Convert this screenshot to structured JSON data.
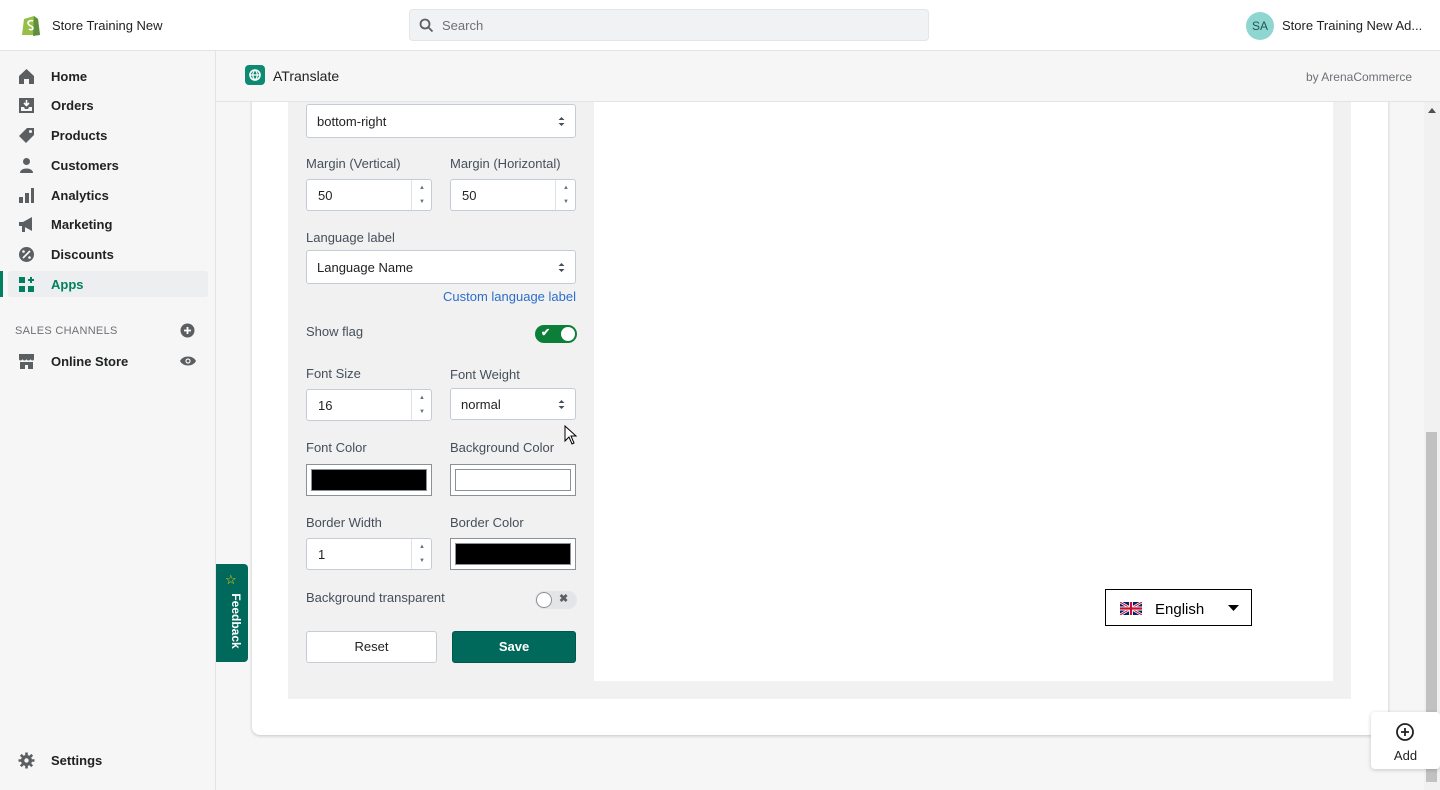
{
  "topbar": {
    "store_name": "Store Training New",
    "search_placeholder": "Search",
    "avatar_initials": "SA",
    "account_name": "Store Training New Ad..."
  },
  "sidebar": {
    "items": [
      {
        "label": "Home",
        "icon": "home-icon"
      },
      {
        "label": "Orders",
        "icon": "orders-icon"
      },
      {
        "label": "Products",
        "icon": "tag-icon"
      },
      {
        "label": "Customers",
        "icon": "person-icon"
      },
      {
        "label": "Analytics",
        "icon": "bar-chart-icon"
      },
      {
        "label": "Marketing",
        "icon": "megaphone-icon"
      },
      {
        "label": "Discounts",
        "icon": "discount-icon"
      },
      {
        "label": "Apps",
        "icon": "apps-icon"
      }
    ],
    "active": "Apps",
    "sales_channels_title": "SALES CHANNELS",
    "online_store": "Online Store",
    "settings": "Settings"
  },
  "app": {
    "title": "ATranslate",
    "by": "by ArenaCommerce"
  },
  "form": {
    "position_value": "bottom-right",
    "margin_vertical_label": "Margin (Vertical)",
    "margin_vertical_value": "50",
    "margin_horizontal_label": "Margin (Horizontal)",
    "margin_horizontal_value": "50",
    "language_label_label": "Language label",
    "language_label_value": "Language Name",
    "custom_language_label": "Custom language label",
    "show_flag_label": "Show flag",
    "show_flag": true,
    "font_size_label": "Font Size",
    "font_size_value": "16",
    "font_weight_label": "Font Weight",
    "font_weight_value": "normal",
    "font_color_label": "Font Color",
    "font_color": "#000000",
    "background_color_label": "Background Color",
    "background_color": "#ffffff",
    "border_width_label": "Border Width",
    "border_width_value": "1",
    "border_color_label": "Border Color",
    "border_color": "#000000",
    "background_transparent_label": "Background transparent",
    "background_transparent": false,
    "reset_label": "Reset",
    "save_label": "Save"
  },
  "preview": {
    "language": "English",
    "flag_icon": "uk-flag-icon"
  },
  "feedback_label": "Feedback",
  "add_label": "Add",
  "colors": {
    "accent": "#008060",
    "save_button": "#00695c",
    "toggle_on": "#0b7f3a"
  }
}
